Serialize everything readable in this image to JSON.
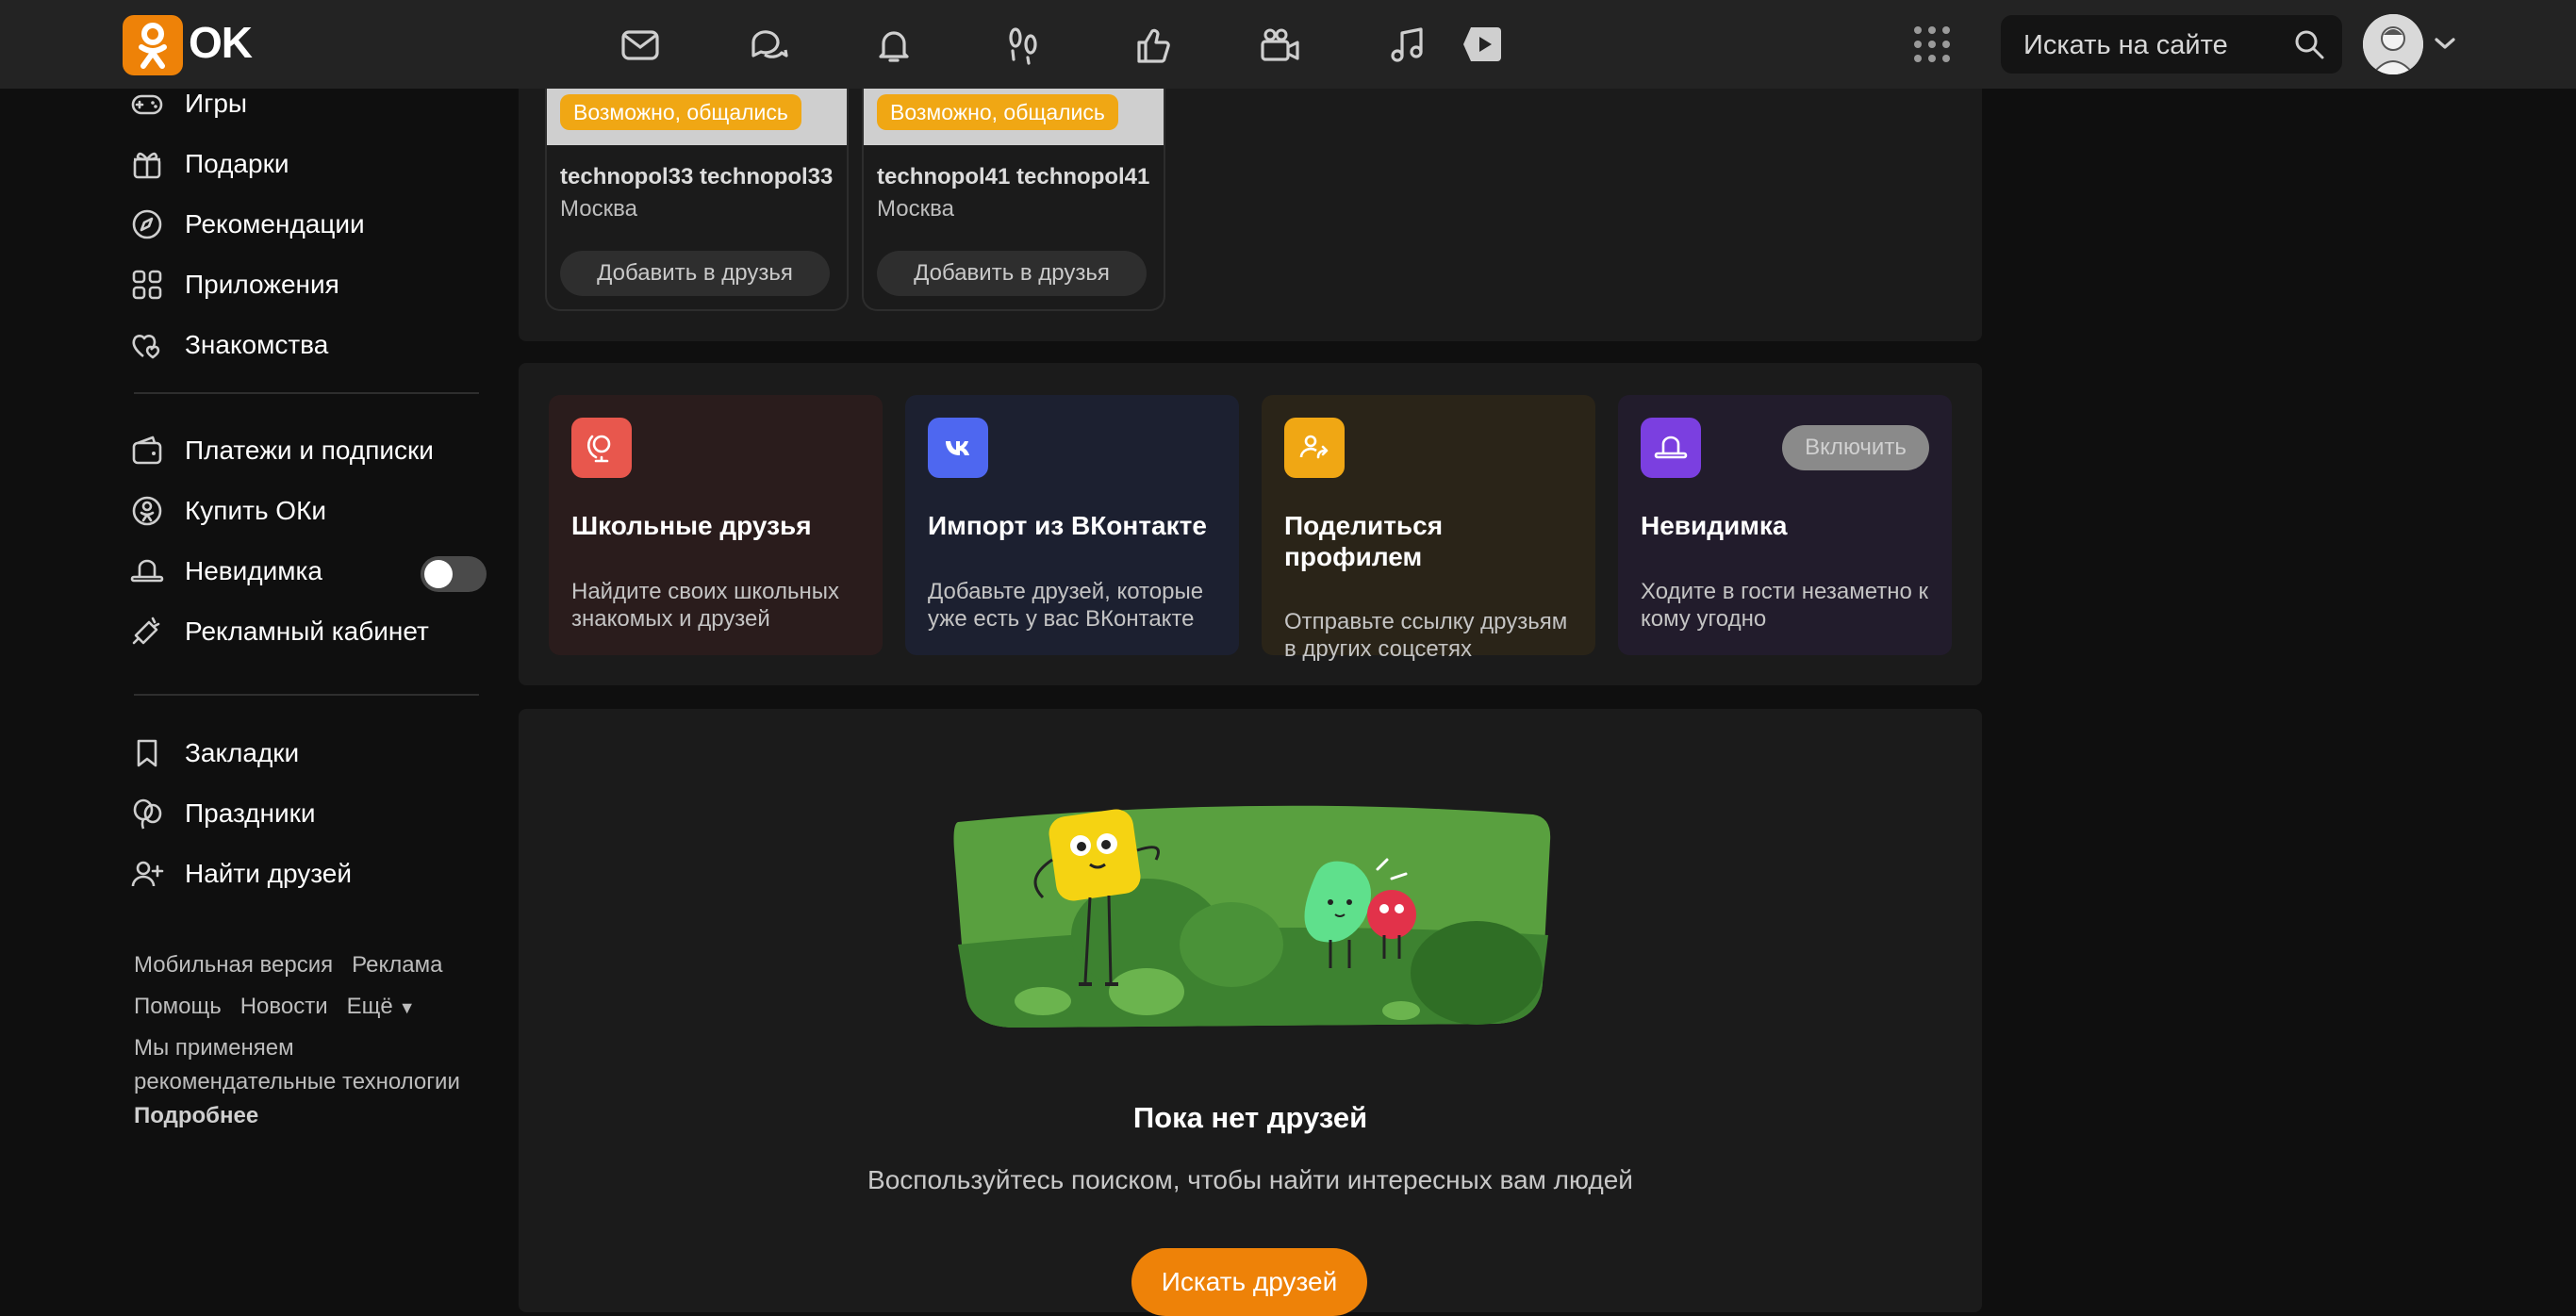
{
  "header": {
    "logo_text": "OK",
    "nav_icons": [
      "mail-icon",
      "chat-icon",
      "bell-icon",
      "footprints-icon",
      "like-icon",
      "video-camera-icon",
      "music-note-icon",
      "video-play-icon"
    ],
    "search_placeholder": "Искать на сайте"
  },
  "sidebar": {
    "items": [
      {
        "label": "Игры",
        "icon": "gamepad-icon"
      },
      {
        "label": "Подарки",
        "icon": "gift-icon"
      },
      {
        "label": "Рекомендации",
        "icon": "compass-icon"
      },
      {
        "label": "Приложения",
        "icon": "apps-grid-icon"
      },
      {
        "label": "Знакомства",
        "icon": "hearts-icon"
      },
      {
        "label": "Платежи и подписки",
        "icon": "wallet-icon"
      },
      {
        "label": "Купить ОКи",
        "icon": "ok-coin-icon"
      },
      {
        "label": "Невидимка",
        "icon": "hat-icon",
        "toggle": false
      },
      {
        "label": "Рекламный кабинет",
        "icon": "megaphone-icon"
      },
      {
        "label": "Закладки",
        "icon": "bookmark-icon"
      },
      {
        "label": "Праздники",
        "icon": "balloons-icon"
      },
      {
        "label": "Найти друзей",
        "icon": "add-user-icon"
      }
    ],
    "footer": {
      "mobile": "Мобильная версия",
      "ads": "Реклама",
      "help": "Помощь",
      "news": "Новости",
      "more": "Ещё",
      "tech_line1": "Мы применяем",
      "tech_line2": "рекомендательные технологии",
      "details": "Подробнее"
    }
  },
  "suggestions": [
    {
      "badge": "Возможно, общались",
      "name": "technopol33 technopol33",
      "city": "Москва",
      "add_label": "Добавить в друзья"
    },
    {
      "badge": "Возможно, общались",
      "name": "technopol41 technopol41",
      "city": "Москва",
      "add_label": "Добавить в друзья"
    }
  ],
  "tiles": [
    {
      "title": "Школьные друзья",
      "desc": "Найдите своих школьных знакомых и друзей",
      "icon": "school-globe-icon",
      "accent": "#e8574d"
    },
    {
      "title": "Импорт из ВКонтакте",
      "desc": "Добавьте друзей, которые уже есть у вас ВКонтакте",
      "icon": "vk-logo-icon",
      "accent": "#4e67f0"
    },
    {
      "title": "Поделиться профилем",
      "desc": "Отправьте ссылку друзьям в других соцсетях",
      "icon": "share-profile-icon",
      "accent": "#f0a714"
    },
    {
      "title": "Невидимка",
      "desc": "Ходите в гости незаметно к кому угодно",
      "icon": "hat-icon",
      "accent": "#7b3fe0",
      "button": "Включить"
    }
  ],
  "empty": {
    "title": "Пока нет друзей",
    "text": "Воспользуйтесь поиском, чтобы найти интересных вам людей",
    "button": "Искать друзей"
  }
}
